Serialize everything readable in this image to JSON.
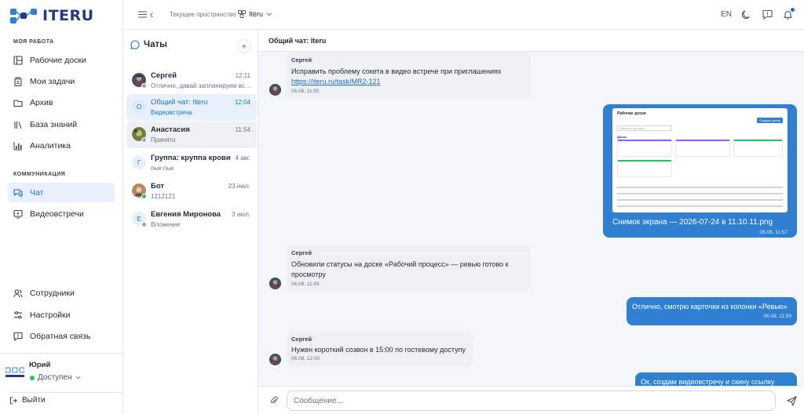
{
  "brand": {
    "name": "ITERU"
  },
  "sidebar": {
    "section_work": "МОЯ РАБОТА",
    "work_items": [
      {
        "label": "Рабочие доски"
      },
      {
        "label": "Мои задачи"
      },
      {
        "label": "Архив"
      },
      {
        "label": "База знаний"
      },
      {
        "label": "Аналитика"
      }
    ],
    "section_comm": "КОММУНИКАЦИЯ",
    "comm_items": [
      {
        "label": "Чат"
      },
      {
        "label": "Видеовстречи"
      }
    ],
    "bottom_items": [
      {
        "label": "Сотрудники"
      },
      {
        "label": "Настройки"
      },
      {
        "label": "Обратная связь"
      }
    ],
    "user": {
      "name": "Юрий",
      "status": "Доступен"
    },
    "logout": "Выйти"
  },
  "topbar": {
    "workspace_label": "Текущее пространство",
    "workspace_name": "Iteru",
    "lang": "EN"
  },
  "chatlist": {
    "title": "Чаты",
    "add": "+",
    "chats": [
      {
        "name": "Сергей",
        "time": "12:11",
        "preview": "Отлично, давай запланируем встр...",
        "avatar": ""
      },
      {
        "name": "Общий чат: Iteru",
        "time": "12:04",
        "preview": "Видеовстреча",
        "avatar": "О"
      },
      {
        "name": "Анастасия",
        "time": "11:54",
        "preview": "Принято",
        "avatar": ""
      },
      {
        "name": "Группа: круппа крови",
        "time": "4 авг.",
        "preview": "пык пык",
        "avatar": "Г"
      },
      {
        "name": "Бот",
        "time": "23 июл.",
        "preview": "1212121",
        "avatar": ""
      },
      {
        "name": "Евгения Миронова",
        "time": "3 июл.",
        "preview": "Вложение",
        "avatar": "Е"
      }
    ]
  },
  "chat": {
    "title": "Общий чат: Iteru",
    "messages": [
      {
        "sender": "Сергей",
        "text": "Исправить проблему сокета в видео встрече при приглашениях",
        "link": "https://iteru.ru/task/MR2-121",
        "time": "06.08, 11:55"
      },
      {
        "file": "Снимок экрана — 2026-07-24 в 11.10.11.png",
        "time": "06.08, 11:57"
      },
      {
        "sender": "Сергей",
        "text1": "Обновили статусы на доске «Рабочий процесс» — ревью готово к",
        "text2": "просмотру",
        "time": "06.08, 11:59"
      },
      {
        "text": "Отлично, смотрю карточки из колонки «Ревью»",
        "time": "06.08, 11:59"
      },
      {
        "sender": "Сергей",
        "text": "Нужен короткий созвон в 15:00 по гостевому доступу",
        "time": "06.08, 12:00"
      },
      {
        "text": "Ок, создам видеовстречу и скину ссылку сюда"
      }
    ],
    "screenshot": {
      "title": "Рабочие доски",
      "search": "Поиск по доскам",
      "btn": "Создать доску",
      "section": "Доски"
    }
  },
  "composer": {
    "placeholder": "Сообщение..."
  },
  "colors": {
    "accent": "#2f80d1",
    "brand": "#1e3a8a",
    "online": "#22c55e"
  }
}
